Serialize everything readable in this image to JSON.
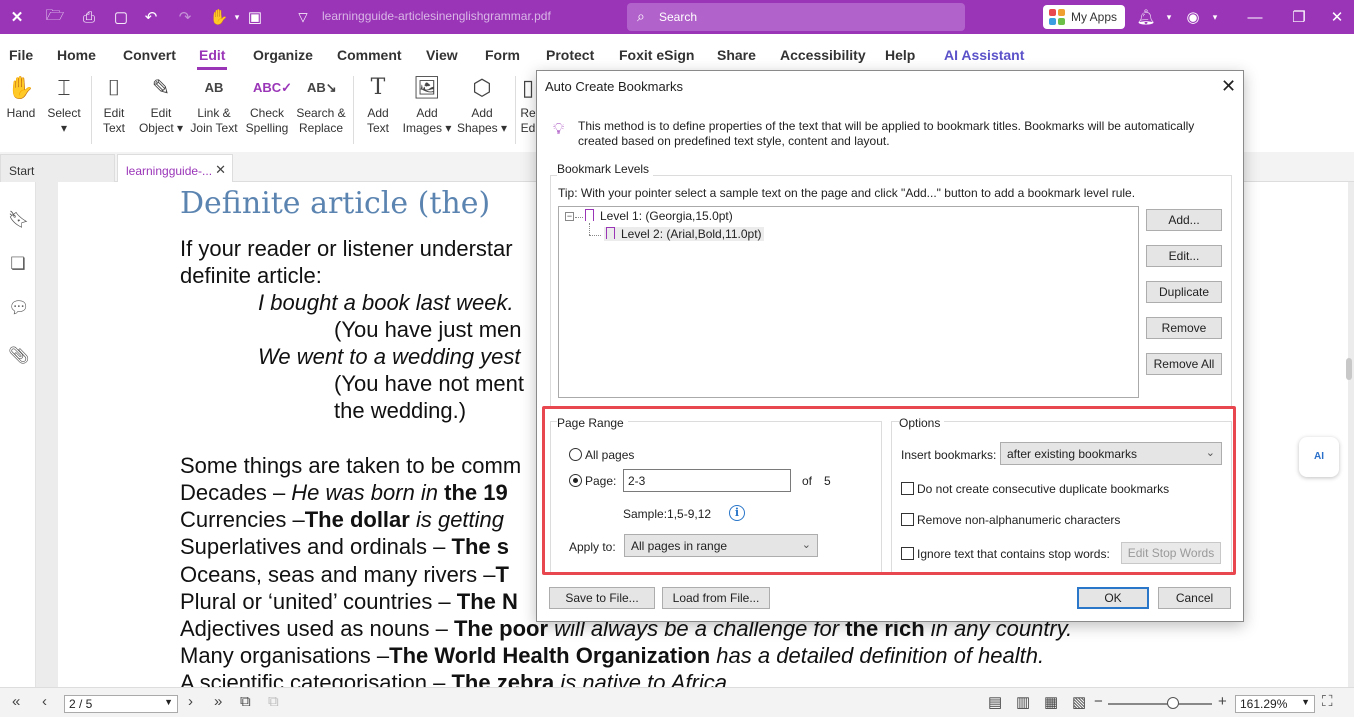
{
  "titlebar": {
    "doc_title": "learningguide-articlesinenglishgrammar.pdf",
    "search_placeholder": "Search",
    "my_apps_label": "My Apps"
  },
  "menu": {
    "items": [
      "File",
      "Home",
      "Convert",
      "Edit",
      "Organize",
      "Comment",
      "View",
      "Form",
      "Protect",
      "Foxit eSign",
      "Share",
      "Accessibility",
      "Help",
      "AI Assistant"
    ],
    "active": "Edit"
  },
  "ribbon": {
    "buttons": [
      {
        "line1": "Hand",
        "line2": ""
      },
      {
        "line1": "Select",
        "line2": "▾"
      },
      {
        "line1": "Edit",
        "line2": "Text"
      },
      {
        "line1": "Edit",
        "line2": "Object ▾"
      },
      {
        "line1": "Link &",
        "line2": "Join Text"
      },
      {
        "line1": "Check",
        "line2": "Spelling"
      },
      {
        "line1": "Search &",
        "line2": "Replace"
      },
      {
        "line1": "Add",
        "line2": "Text"
      },
      {
        "line1": "Add",
        "line2": "Images ▾"
      },
      {
        "line1": "Add",
        "line2": "Shapes ▾"
      },
      {
        "line1": "Re",
        "line2": "Ed"
      }
    ]
  },
  "tabs": {
    "start": "Start",
    "doc": "learningguide-..."
  },
  "document": {
    "heading": "Definite article (the)",
    "lines": [
      {
        "pre": "If your reader or listener understar",
        "it": "",
        "b": "",
        "post": ""
      },
      {
        "pre": "definite article:",
        "it": "",
        "b": "",
        "post": ""
      },
      {
        "pre": "",
        "it": "I bought a book last week.",
        "b": "",
        "post": ""
      },
      {
        "pre": "(You have just men",
        "it": "",
        "b": "",
        "post": ""
      },
      {
        "pre": "",
        "it": "We went to a wedding yest",
        "b": "",
        "post": ""
      },
      {
        "pre": "(You have not ment",
        "it": "",
        "b": "",
        "post": ""
      },
      {
        "pre": "the wedding.)",
        "it": "",
        "b": "",
        "post": ""
      },
      {
        "pre": "Some things are taken to be comm",
        "it": "",
        "b": "",
        "post": ""
      },
      {
        "pre": "Decades – ",
        "it": "He was born in ",
        "b": "the 19",
        "post": ""
      },
      {
        "pre": "Currencies –",
        "it": "",
        "b": "The dollar",
        "post": " is getting"
      },
      {
        "pre": "Superlatives and ordinals – ",
        "it": "",
        "b": "The s",
        "post": ""
      },
      {
        "pre": "Oceans, seas and many rivers –",
        "it": "",
        "b": "T",
        "post": ""
      },
      {
        "pre": "Plural or ‘united’ countries – ",
        "it": "",
        "b": "The N",
        "post": ""
      },
      {
        "pre": "Adjectives used as nouns – ",
        "it": "",
        "b": "The poor",
        "post": " will always be a challenge for ",
        "b2": "the rich",
        "post2": " in any country."
      },
      {
        "pre": "Many organisations –",
        "it": "",
        "b": "The World Health Organization",
        "post": " has a detailed definition of health."
      },
      {
        "pre": "A scientific categorisation – ",
        "it": "",
        "b": "The zebra",
        "post": " is native to Africa"
      }
    ]
  },
  "statusbar": {
    "page": "2 / 5",
    "zoom": "161.29%"
  },
  "dialog": {
    "title": "Auto Create Bookmarks",
    "description": "This method is to define properties of the text that will be applied to bookmark titles. Bookmarks will be automatically created based on predefined text style, content and layout.",
    "bookmark_levels_label": "Bookmark Levels",
    "tip": "Tip: With your pointer select a sample text on the page and click \"Add...\" button to add a bookmark level rule.",
    "levels": [
      "Level 1: (Georgia,15.0pt)",
      "Level 2: (Arial,Bold,11.0pt)"
    ],
    "side_buttons": [
      "Add...",
      "Edit...",
      "Duplicate",
      "Remove",
      "Remove All"
    ],
    "page_range": {
      "label": "Page Range",
      "all_pages": "All pages",
      "page_label": "Page:",
      "page_value": "2-3",
      "of_label": "of",
      "total": "5",
      "sample": "Sample:1,5-9,12",
      "apply_to_label": "Apply to:",
      "apply_to_value": "All pages in range",
      "selected": "page"
    },
    "options": {
      "label": "Options",
      "insert_label": "Insert bookmarks:",
      "insert_value": "after existing bookmarks",
      "no_duplicates": "Do not create consecutive duplicate bookmarks",
      "remove_nonalnum": "Remove non-alphanumeric characters",
      "ignore_stop": "Ignore text that contains stop words:",
      "edit_stop_words": "Edit Stop Words"
    },
    "save_to_file": "Save to File...",
    "load_from_file": "Load from File...",
    "ok": "OK",
    "cancel": "Cancel"
  },
  "colors": {
    "brand": "#9a35b8",
    "heading": "#5b84b1",
    "highlight": "#e8474f",
    "primary_button": "#2a76c9"
  }
}
